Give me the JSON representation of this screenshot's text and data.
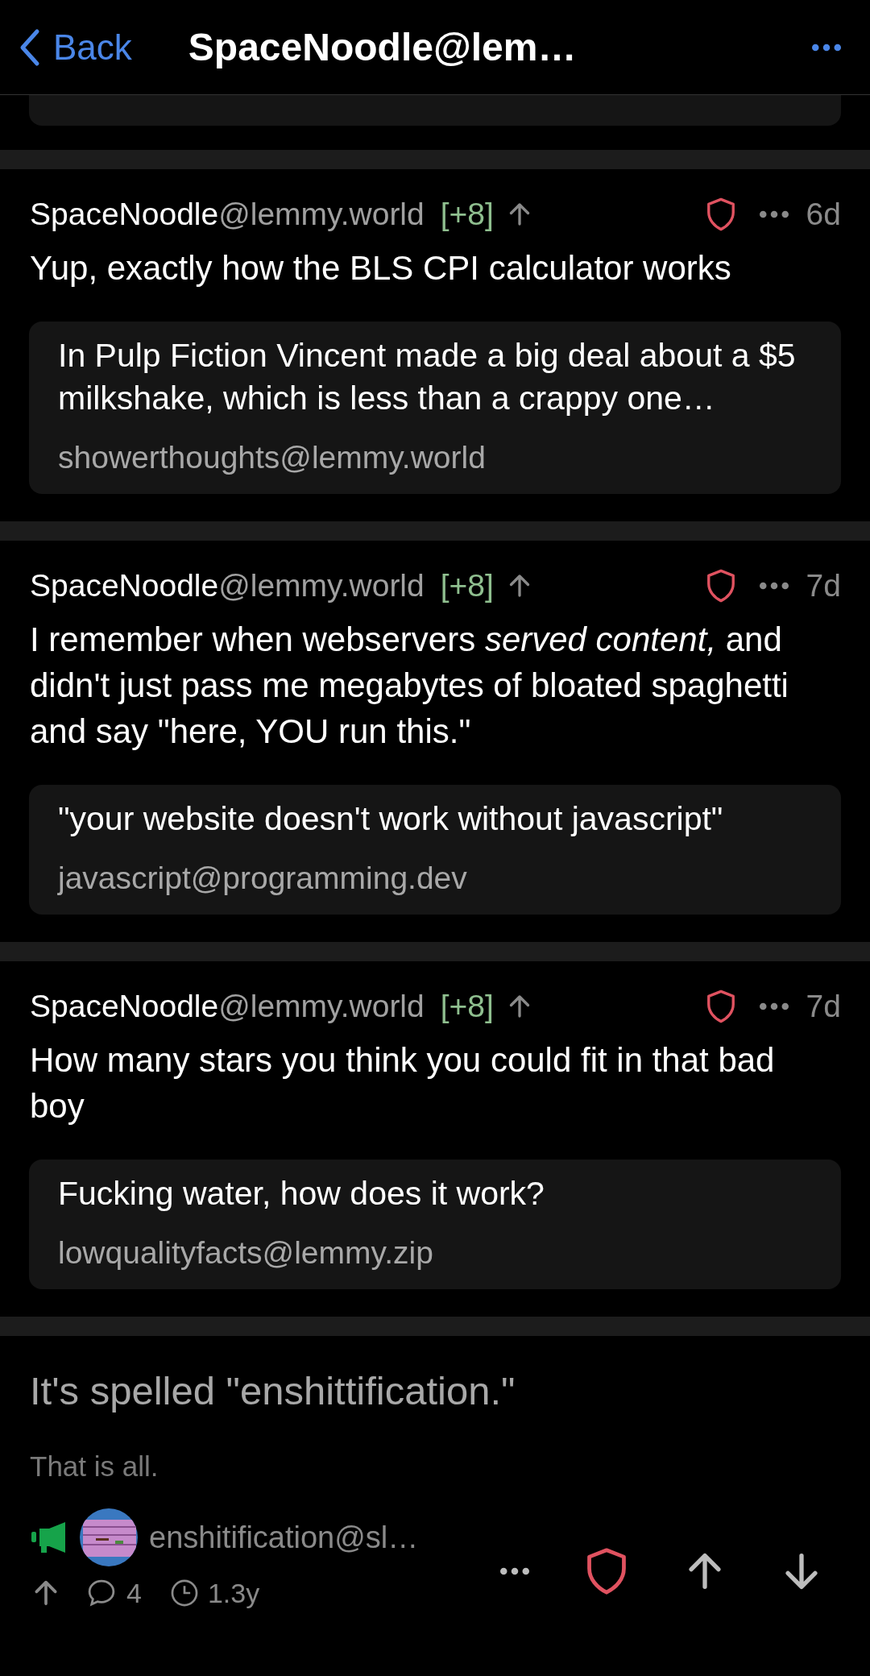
{
  "header": {
    "back_label": "Back",
    "title": "SpaceNoodle@lem…"
  },
  "comments": [
    {
      "user": "SpaceNoodle",
      "instance": "@lemmy.world",
      "score": "[+8]",
      "age": "6d",
      "body": "Yup, exactly how the BLS CPI calculator works",
      "quote": {
        "title": "In Pulp Fiction Vincent made a big deal about a $5 milkshake, which is less than a crappy one…",
        "community": "showerthoughts@lemmy.world"
      }
    },
    {
      "user": "SpaceNoodle",
      "instance": "@lemmy.world",
      "score": "[+8]",
      "age": "7d",
      "body": "I remember when webservers *served content,* and didn't just pass me megabytes of bloated spaghetti and say \"here, YOU run this.\"",
      "quote": {
        "title": "\"your website doesn't work without javascript\"",
        "community": "javascript@programming.dev"
      }
    },
    {
      "user": "SpaceNoodle",
      "instance": "@lemmy.world",
      "score": "[+8]",
      "age": "7d",
      "body": "How many stars you think you could fit in that bad boy",
      "quote": {
        "title": "Fucking water, how does it work?",
        "community": "lowqualityfacts@lemmy.zip"
      }
    }
  ],
  "post": {
    "title": "It's spelled \"enshittification.\"",
    "body": "That is all.",
    "featured": true,
    "community": "enshitification@sl…",
    "comment_count": "4",
    "age": "1.3y"
  }
}
